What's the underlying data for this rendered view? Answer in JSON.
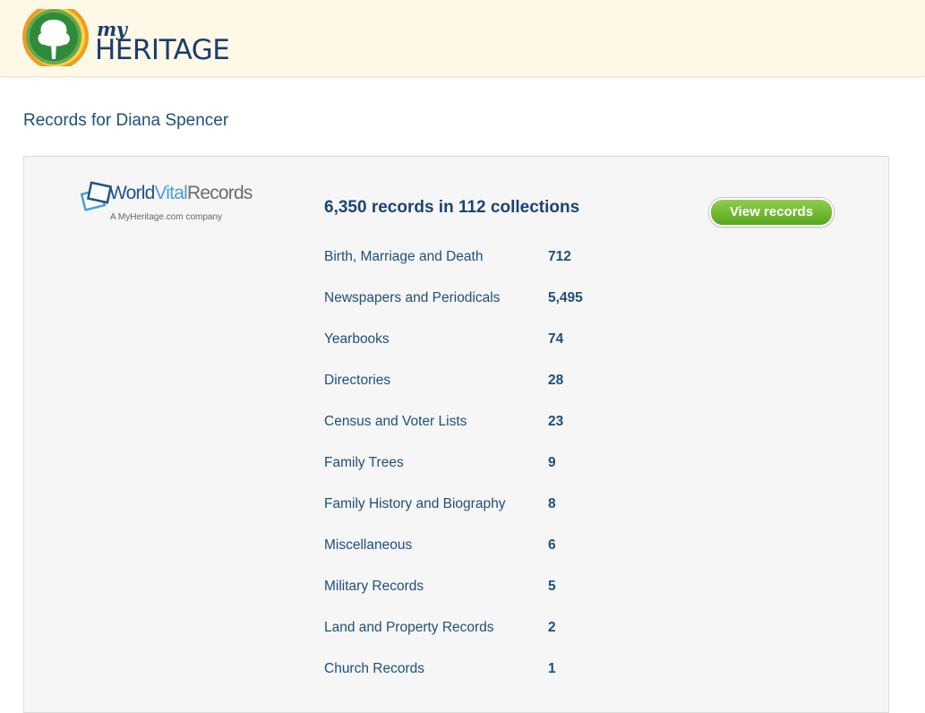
{
  "header": {
    "logo_my": "my",
    "logo_heritage": "HERITAGE"
  },
  "page": {
    "title": "Records for Diana Spencer"
  },
  "provider": {
    "name_part1": "World",
    "name_part2": "Vital",
    "name_part3": "Records",
    "tagline": "A MyHeritage.com company"
  },
  "summary": "6,350 records in 112 collections",
  "view_button_label": "View records",
  "categories": [
    {
      "label": "Birth, Marriage and Death",
      "count": "712"
    },
    {
      "label": "Newspapers and Periodicals",
      "count": "5,495"
    },
    {
      "label": "Yearbooks",
      "count": "74"
    },
    {
      "label": "Directories",
      "count": "28"
    },
    {
      "label": "Census and Voter Lists",
      "count": "23"
    },
    {
      "label": "Family Trees",
      "count": "9"
    },
    {
      "label": "Family History and Biography",
      "count": "8"
    },
    {
      "label": "Miscellaneous",
      "count": "6"
    },
    {
      "label": "Military Records",
      "count": "5"
    },
    {
      "label": "Land and Property Records",
      "count": "2"
    },
    {
      "label": "Church Records",
      "count": "1"
    }
  ],
  "colors": {
    "header_bg": "#fdf9e6",
    "brand_blue": "#1b3d6e",
    "link_blue": "#1f4f7a",
    "button_green": "#6cb52c",
    "logo_orange": "#f29a1f",
    "logo_green": "#2e8b3a"
  }
}
